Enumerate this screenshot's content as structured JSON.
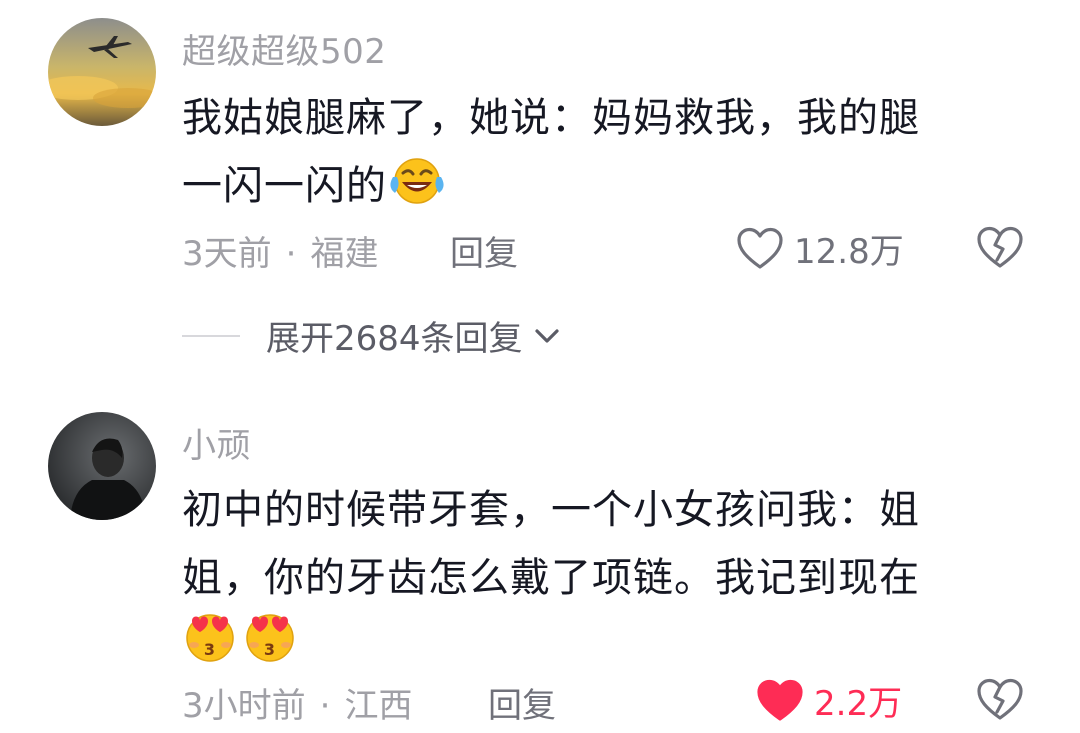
{
  "comments": [
    {
      "username": "超级超级502",
      "text_line1": "我姑娘腿麻了，她说：妈妈救我，我的腿",
      "text_line2": "一闪一闪的",
      "emoji": "laughing-tears-emoji",
      "time": "3天前",
      "separator": "·",
      "location": "福建",
      "reply_label": "回复",
      "likes": "12.8万",
      "liked": false
    },
    {
      "username": "小顽",
      "text_line1": "初中的时候带牙套，一个小女孩问我：姐",
      "text_line2": "姐，你的牙齿怎么戴了项链。我记到现在",
      "emoji": "heart-eyes-kiss-emoji",
      "time": "3小时前",
      "separator": "·",
      "location": "江西",
      "reply_label": "回复",
      "likes": "2.2万",
      "liked": true
    }
  ],
  "expand_replies": {
    "label": "展开2684条回复"
  },
  "colors": {
    "text": "#161823",
    "muted": "#a0a0a6",
    "like_active": "#fe2c55"
  },
  "icons": [
    "heart-icon",
    "broken-heart-icon",
    "chevron-down-icon"
  ]
}
